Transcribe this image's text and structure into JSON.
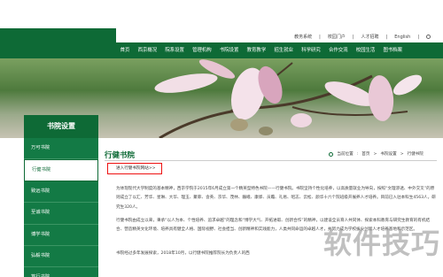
{
  "header": {
    "top_links": [
      "教务系统",
      "校园门户",
      "人才招聘",
      "English"
    ]
  },
  "nav": {
    "items": [
      "首页",
      "西京概况",
      "院系设置",
      "管理机构",
      "书院设置",
      "教育教学",
      "招生就业",
      "科学研究",
      "合作交流",
      "校园生活",
      "图书档案"
    ]
  },
  "sidebar": {
    "title": "书院设置",
    "items": [
      {
        "label": "万可书院"
      },
      {
        "label": "行健书院",
        "active": true
      },
      {
        "label": "致远书院"
      },
      {
        "label": "至诚书院"
      },
      {
        "label": "博学书院"
      },
      {
        "label": "弘毅书院"
      },
      {
        "label": "笃行书院"
      }
    ]
  },
  "main": {
    "title": "行健书院",
    "breadcrumb": [
      "当前位置",
      "首页",
      "书院设置",
      "行健书院"
    ],
    "link_text": "进入行健书院网站>>",
    "paragraphs": [
      "为体现现代大学制度的基本精神，西京学院于2015年6月成立第一个精英型特色书院——行健书院。书院坚持个性化培养，以高质量就业为导向，按照“文理渗透、中外交叉”的原则成立了以汇、芳华、星琳、大华、理玉、聚菲、含英、京华、茂林、巍峨、康骅、员瞻、礼易、昭志、云松、颜华十六个院班级开展养人才培养。目前已入驻本科生4563人，研究生320人。",
      "行健书院由成立以来，秉承“以人为本、个性培养、追求卓越”的理念和“博学大气、开拓进取、创新合作”的精神，以建设全员育人共同体、探索本科教育与研究生教育的有机结合、营造精英文化环境、培养具有健全人格、国际视野、社会担当、创新精神和实践能力，人类共同命运的卓越人才，并努力成为学校拔尖创新人才培养基地和示范区。",
      "书院经过多年发展探索，2018年10月，以行健书院推荐院长为负责人的西"
    ]
  },
  "watermark": "软件技巧",
  "colors": {
    "brand_green": "#0e6a36",
    "sidebar_green": "#137a45",
    "highlight_red": "#e11111"
  }
}
